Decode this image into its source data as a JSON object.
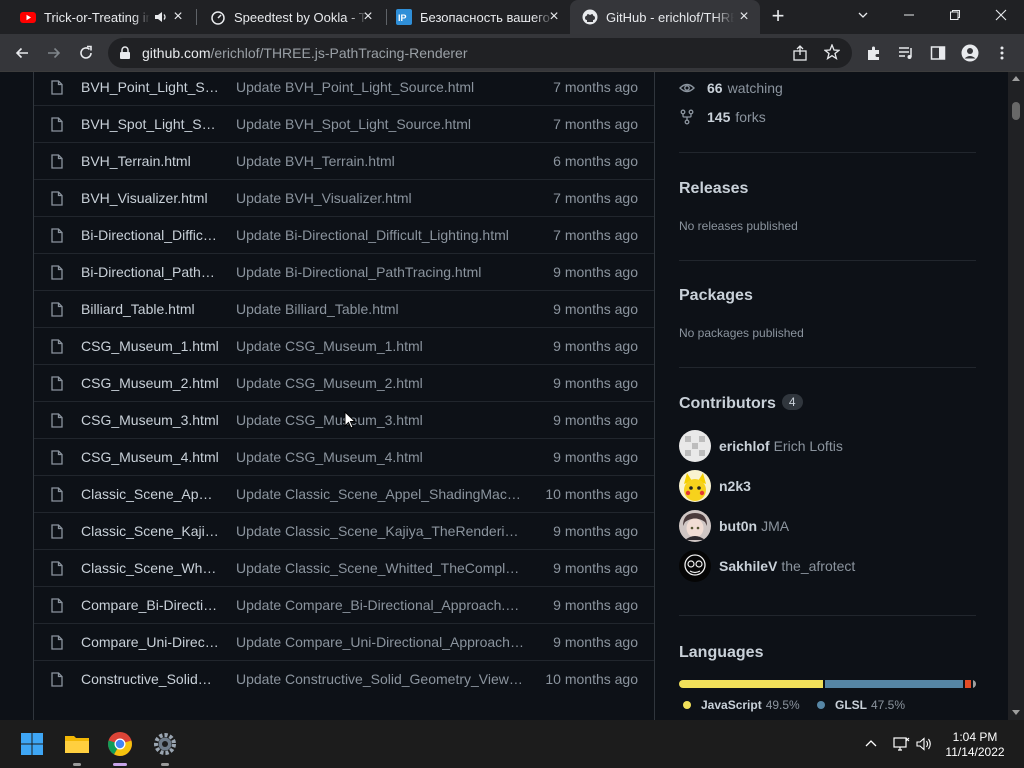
{
  "browser": {
    "tabs": [
      {
        "title": "Trick-or-Treating in",
        "favicon": "youtube-icon",
        "audio": true
      },
      {
        "title": "Speedtest by Ookla - Th",
        "favicon": "speedtest-icon"
      },
      {
        "title": "Безопасность вашего",
        "favicon": "ip-icon"
      },
      {
        "title": "GitHub - erichlof/THRE",
        "favicon": "github-icon",
        "active": true
      }
    ],
    "url_host": "github.com",
    "url_path": "/erichlof/THREE.js-PathTracing-Renderer"
  },
  "files": [
    {
      "name": "BVH_Point_Light_Source.html",
      "commit": "Update BVH_Point_Light_Source.html",
      "age": "7 months ago"
    },
    {
      "name": "BVH_Spot_Light_Source.html",
      "commit": "Update BVH_Spot_Light_Source.html",
      "age": "7 months ago"
    },
    {
      "name": "BVH_Terrain.html",
      "commit": "Update BVH_Terrain.html",
      "age": "6 months ago"
    },
    {
      "name": "BVH_Visualizer.html",
      "commit": "Update BVH_Visualizer.html",
      "age": "7 months ago"
    },
    {
      "name": "Bi-Directional_Difficult_Lighting.html",
      "commit": "Update Bi-Directional_Difficult_Lighting.html",
      "age": "7 months ago"
    },
    {
      "name": "Bi-Directional_PathTracing.html",
      "commit": "Update Bi-Directional_PathTracing.html",
      "age": "9 months ago"
    },
    {
      "name": "Billiard_Table.html",
      "commit": "Update Billiard_Table.html",
      "age": "9 months ago"
    },
    {
      "name": "CSG_Museum_1.html",
      "commit": "Update CSG_Museum_1.html",
      "age": "9 months ago"
    },
    {
      "name": "CSG_Museum_2.html",
      "commit": "Update CSG_Museum_2.html",
      "age": "9 months ago"
    },
    {
      "name": "CSG_Museum_3.html",
      "commit": "Update CSG_Museum_3.html",
      "age": "9 months ago"
    },
    {
      "name": "CSG_Museum_4.html",
      "commit": "Update CSG_Museum_4.html",
      "age": "9 months ago"
    },
    {
      "name": "Classic_Scene_Appel_ShadingMachine.html",
      "commit": "Update Classic_Scene_Appel_ShadingMachine.html",
      "age": "10 months ago"
    },
    {
      "name": "Classic_Scene_Kajiya_TheRenderingEquation.html",
      "commit": "Update Classic_Scene_Kajiya_TheRenderingEquation.html",
      "age": "9 months ago"
    },
    {
      "name": "Classic_Scene_Whitted_TheCompleatAngler.html",
      "commit": "Update Classic_Scene_Whitted_TheCompleatAngler.html",
      "age": "9 months ago"
    },
    {
      "name": "Compare_Bi-Directional_Approach.html",
      "commit": "Update Compare_Bi-Directional_Approach.html",
      "age": "9 months ago"
    },
    {
      "name": "Compare_Uni-Directional_Approach.html",
      "commit": "Update Compare_Uni-Directional_Approach.html",
      "age": "9 months ago"
    },
    {
      "name": "Constructive_Solid_Geometry_Viewer.html",
      "commit": "Update Constructive_Solid_Geometry_Viewer.html",
      "age": "10 months ago"
    }
  ],
  "sidebar": {
    "watching_count": "66",
    "watching_label": "watching",
    "forks_count": "145",
    "forks_label": "forks",
    "releases_title": "Releases",
    "releases_empty": "No releases published",
    "packages_title": "Packages",
    "packages_empty": "No packages published",
    "contributors_title": "Contributors",
    "contributors_count": "4",
    "contributors": [
      {
        "login": "erichlof",
        "name": "Erich Loftis"
      },
      {
        "login": "n2k3",
        "name": ""
      },
      {
        "login": "but0n",
        "name": "JMA"
      },
      {
        "login": "SakhileV",
        "name": "the_afrotect"
      }
    ],
    "languages_title": "Languages",
    "languages": [
      {
        "name": "JavaScript",
        "percent": "49.5%",
        "share": 49.5,
        "color": "#f1e05a"
      },
      {
        "name": "GLSL",
        "percent": "47.5%",
        "share": 47.5,
        "color": "#5686a5"
      },
      {
        "name": "",
        "percent": "",
        "share": 2.0,
        "color": "#e34c26"
      },
      {
        "name": "",
        "percent": "",
        "share": 1.0,
        "color": "#a0a0a0"
      }
    ]
  },
  "taskbar": {
    "time": "1:04 PM",
    "date": "11/14/2022",
    "apps": [
      "windows-start-icon",
      "file-explorer-icon",
      "chrome-icon",
      "settings-icon"
    ]
  },
  "colors": {
    "page_bg": "#0d1117",
    "text": "#c9d1d9",
    "muted": "#8b949e",
    "border": "#21262d"
  }
}
